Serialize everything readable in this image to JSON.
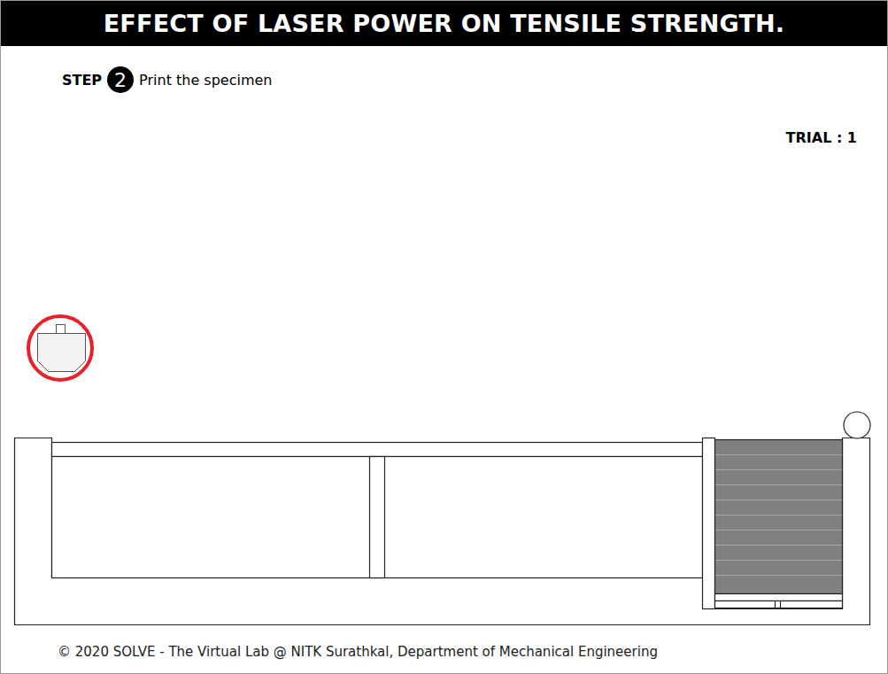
{
  "header": {
    "title": "EFFECT OF LASER POWER ON TENSILE STRENGTH."
  },
  "step": {
    "label": "STEP",
    "number": "2",
    "text": "Print the specimen"
  },
  "trial": "TRIAL : 1",
  "laser_head": {
    "highlighted": true
  },
  "footer": "© 2020 SOLVE - The Virtual Lab @ NITK Surathkal, Department of Mechanical Engineering"
}
